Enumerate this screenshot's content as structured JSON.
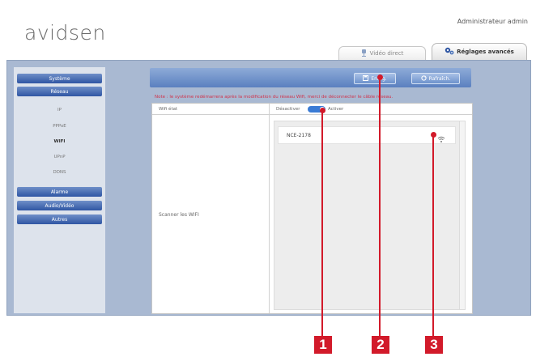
{
  "header": {
    "logo": "avidsen",
    "user_label": "Administrateur admin"
  },
  "tabs": [
    {
      "label": "Vidéo direct"
    },
    {
      "label": "Réglages avancés"
    }
  ],
  "sidebar": {
    "top_items": [
      {
        "label": "Système"
      },
      {
        "label": "Réseau"
      }
    ],
    "sub_items": [
      {
        "label": "IP"
      },
      {
        "label": "PPPoE"
      },
      {
        "label": "WIFI"
      },
      {
        "label": "UPnP"
      },
      {
        "label": "DDNS"
      }
    ],
    "bottom_items": [
      {
        "label": "Alarme"
      },
      {
        "label": "Audio/Vidéo"
      },
      {
        "label": "Autres"
      }
    ]
  },
  "toolbar": {
    "save_label": "Enreg.",
    "refresh_label": "Rafraîch."
  },
  "notice": "Note : le système redémarrera après la modification du réseau Wifi, merci de déconnecter le câble réseau.",
  "form": {
    "status_label": "Wifi état",
    "off_label": "Désactiver",
    "on_label": "Activer",
    "scan_label": "Scanner les WIFI",
    "networks": [
      {
        "ssid": "NCE-2178"
      }
    ]
  },
  "markers": [
    "1",
    "2",
    "3"
  ],
  "colors": {
    "accent_blue": "#3a7bd5",
    "frame_blue": "#a9b9d2",
    "marker_red": "#d21a2a",
    "notice_red": "#d0324a"
  }
}
